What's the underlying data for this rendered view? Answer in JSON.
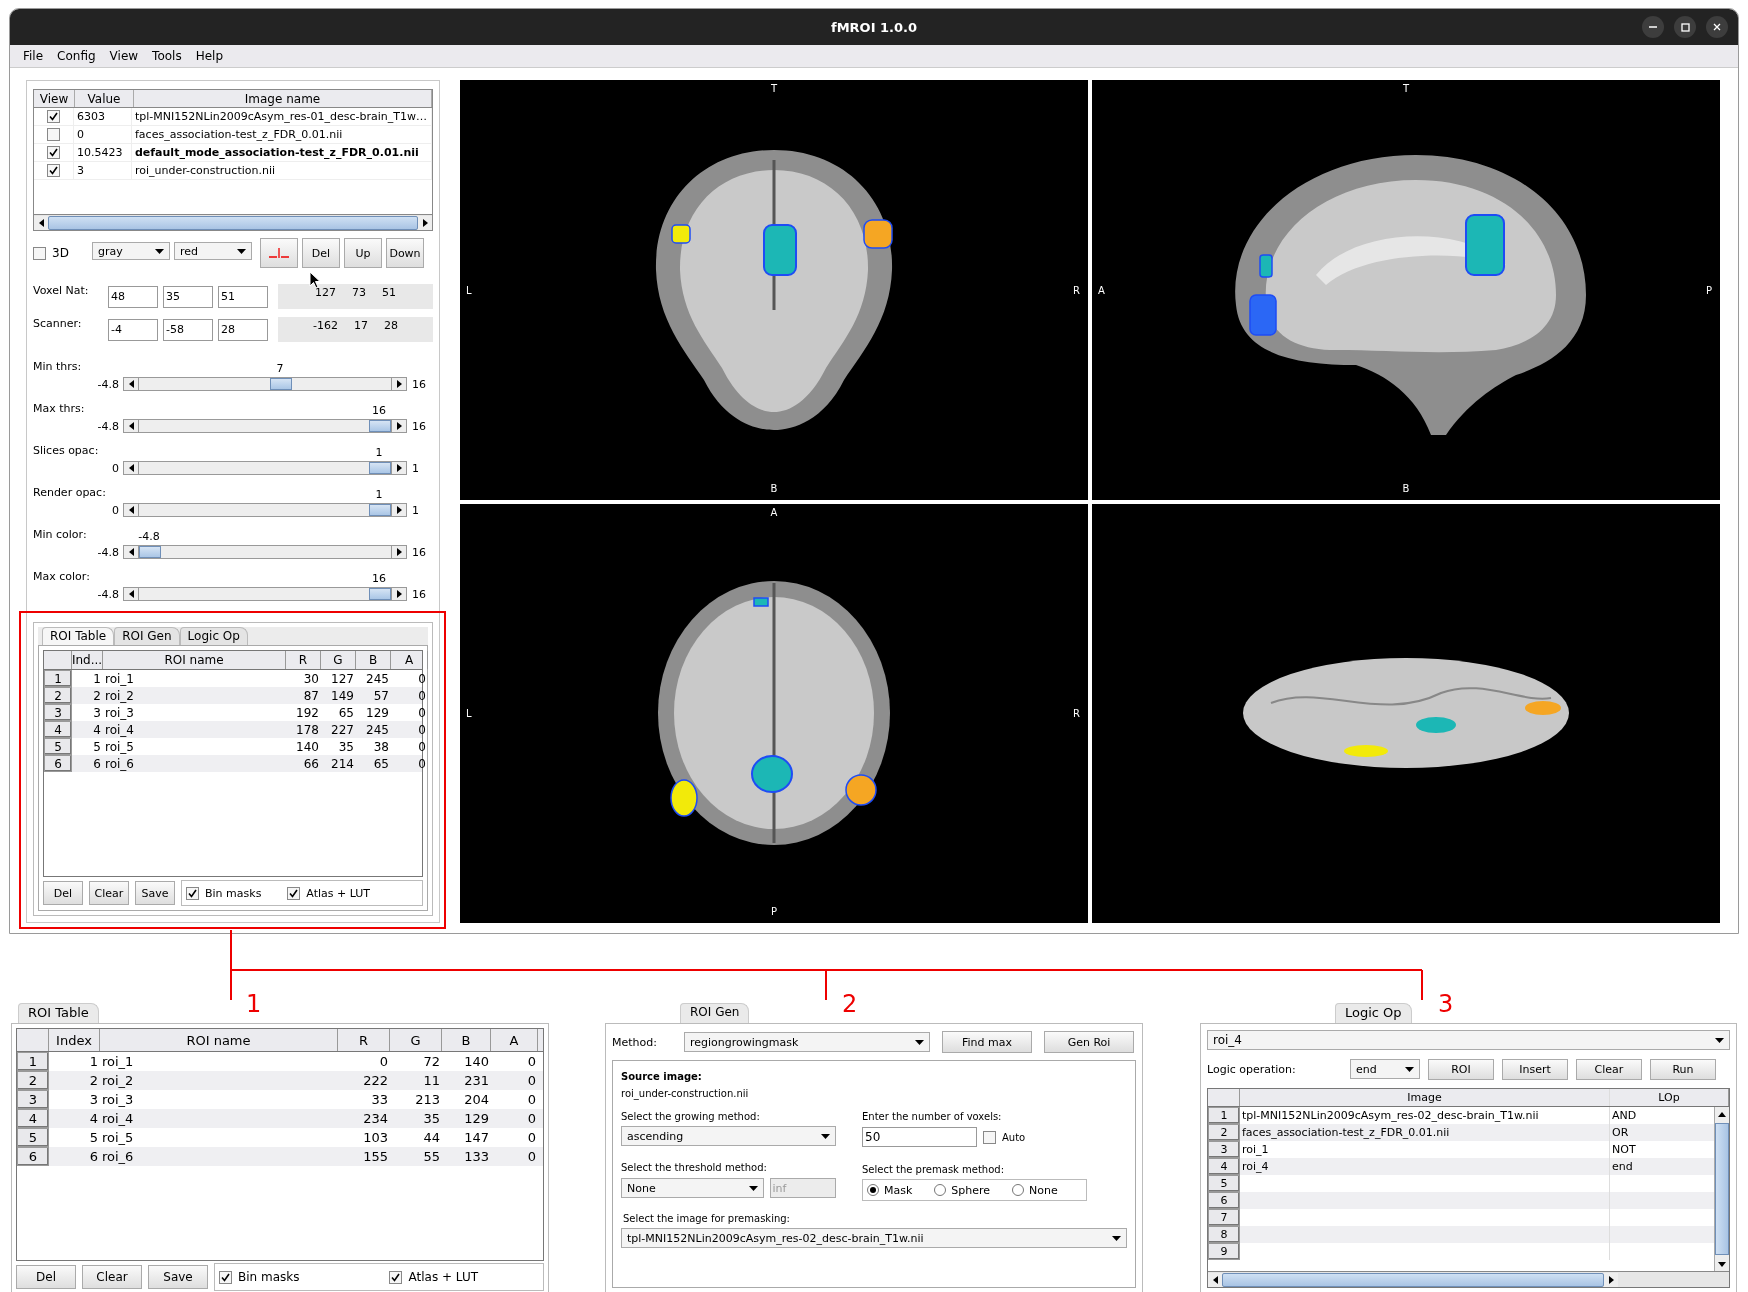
{
  "window": {
    "title": "fMROI 1.0.0"
  },
  "menu": [
    "File",
    "Config",
    "View",
    "Tools",
    "Help"
  ],
  "image_table": {
    "columns": [
      "View",
      "Value",
      "Image name"
    ],
    "rows": [
      {
        "checked": true,
        "value": "6303",
        "name": "tpl-MNI152NLin2009cAsym_res-01_desc-brain_T1w…",
        "selected": false
      },
      {
        "checked": false,
        "value": "0",
        "name": "faces_association-test_z_FDR_0.01.nii",
        "selected": false
      },
      {
        "checked": true,
        "value": "10.5423",
        "name": "default_mode_association-test_z_FDR_0.01.nii",
        "selected": true
      },
      {
        "checked": true,
        "value": "3",
        "name": "roi_under-construction.nii",
        "selected": false
      }
    ]
  },
  "display": {
    "three_d": {
      "label": "3D",
      "checked": false
    },
    "colormaps": [
      "gray",
      "red"
    ],
    "buttons": [
      "Del",
      "Up",
      "Down"
    ]
  },
  "coordinates": [
    {
      "label": "Voxel Nat:",
      "values": [
        "48",
        "35",
        "51"
      ],
      "readout": [
        "127",
        "73",
        "51"
      ]
    },
    {
      "label": "Scanner:",
      "values": [
        "-4",
        "-58",
        "28"
      ],
      "readout": [
        "-162",
        "17",
        "28"
      ]
    }
  ],
  "sliders": [
    {
      "label": "Min thrs:",
      "value": "7",
      "min": "-4.8",
      "max": "16",
      "level": 0.57
    },
    {
      "label": "Max thrs:",
      "value": "16",
      "min": "-4.8",
      "max": "16",
      "level": 1
    },
    {
      "label": "Slices opac:",
      "value": "1",
      "min": "0",
      "max": "1",
      "level": 1
    },
    {
      "label": "Render opac:",
      "value": "1",
      "min": "0",
      "max": "1",
      "level": 1
    },
    {
      "label": "Min color:",
      "value": "-4.8",
      "min": "-4.8",
      "max": "16",
      "level": 0
    },
    {
      "label": "Max color:",
      "value": "16",
      "min": "-4.8",
      "max": "16",
      "level": 1
    }
  ],
  "roi_panel": {
    "tabs": [
      {
        "label": "ROI Table",
        "selected": true
      },
      {
        "label": "ROI Gen",
        "selected": false
      },
      {
        "label": "Logic Op",
        "selected": false
      }
    ],
    "table": {
      "columns": [
        "Ind...",
        "ROI name",
        "R",
        "G",
        "B",
        "A"
      ],
      "rows": [
        {
          "number": "1",
          "index": "1",
          "name": "roi_1",
          "r": "30",
          "g": "127",
          "b": "245",
          "a": "0"
        },
        {
          "number": "2",
          "index": "2",
          "name": "roi_2",
          "r": "87",
          "g": "149",
          "b": "57",
          "a": "0"
        },
        {
          "number": "3",
          "index": "3",
          "name": "roi_3",
          "r": "192",
          "g": "65",
          "b": "129",
          "a": "0"
        },
        {
          "number": "4",
          "index": "4",
          "name": "roi_4",
          "r": "178",
          "g": "227",
          "b": "245",
          "a": "0"
        },
        {
          "number": "5",
          "index": "5",
          "name": "roi_5",
          "r": "140",
          "g": "35",
          "b": "38",
          "a": "0"
        },
        {
          "number": "6",
          "index": "6",
          "name": "roi_6",
          "r": "66",
          "g": "214",
          "b": "65",
          "a": "0"
        }
      ]
    },
    "buttons": [
      "Del",
      "Clear",
      "Save"
    ],
    "options": [
      {
        "label": "Bin masks",
        "checked": true
      },
      {
        "label": "Atlas + LUT",
        "checked": true
      }
    ]
  },
  "views": [
    {
      "kind": "coronal",
      "top": "T",
      "left": "L",
      "right": "R",
      "bottom": "B"
    },
    {
      "kind": "sagittal",
      "top": "T",
      "left": "A",
      "right": "P",
      "bottom": "B"
    },
    {
      "kind": "axial",
      "top": "A",
      "left": "L",
      "right": "R",
      "bottom": "P"
    },
    {
      "kind": "render"
    }
  ],
  "callouts": [
    "1",
    "2",
    "3"
  ],
  "zoom_roi_table": {
    "tab": "ROI Table",
    "columns": [
      "Index",
      "ROI name",
      "R",
      "G",
      "B",
      "A"
    ],
    "rows": [
      {
        "number": "1",
        "index": "1",
        "name": "roi_1",
        "r": "0",
        "g": "72",
        "b": "140",
        "a": "0"
      },
      {
        "number": "2",
        "index": "2",
        "name": "roi_2",
        "r": "222",
        "g": "11",
        "b": "231",
        "a": "0"
      },
      {
        "number": "3",
        "index": "3",
        "name": "roi_3",
        "r": "33",
        "g": "213",
        "b": "204",
        "a": "0"
      },
      {
        "number": "4",
        "index": "4",
        "name": "roi_4",
        "r": "234",
        "g": "35",
        "b": "129",
        "a": "0"
      },
      {
        "number": "5",
        "index": "5",
        "name": "roi_5",
        "r": "103",
        "g": "44",
        "b": "147",
        "a": "0"
      },
      {
        "number": "6",
        "index": "6",
        "name": "roi_6",
        "r": "155",
        "g": "55",
        "b": "133",
        "a": "0"
      }
    ],
    "buttons": [
      "Del",
      "Clear",
      "Save"
    ],
    "options": [
      {
        "label": "Bin masks",
        "checked": true
      },
      {
        "label": "Atlas + LUT",
        "checked": true
      }
    ]
  },
  "zoom_roi_gen": {
    "tab": "ROI Gen",
    "method_label": "Method:",
    "method": "regiongrowingmask",
    "buttons": [
      "Find max",
      "Gen Roi"
    ],
    "source_label": "Source image:",
    "source": "roi_under-construction.nii",
    "growing_label": "Select the growing method:",
    "growing": "ascending",
    "voxels_label": "Enter the number of voxels:",
    "voxels": "50",
    "auto": {
      "label": "Auto",
      "checked": false
    },
    "threshold_label": "Select the threshold method:",
    "threshold": "None",
    "threshold_value": {
      "value": "inf",
      "disabled": true
    },
    "premask_label": "Select the premask method:",
    "premask_options": [
      {
        "label": "Mask",
        "selected": true
      },
      {
        "label": "Sphere",
        "selected": false
      },
      {
        "label": "None",
        "selected": false
      }
    ],
    "premask_image_label": "Select the image for premasking:",
    "premask_image": "tpl-MNI152NLin2009cAsym_res-02_desc-brain_T1w.nii"
  },
  "zoom_logic_op": {
    "tab": "Logic Op",
    "roi": "roi_4",
    "operation_label": "Logic operation:",
    "operation": "end",
    "buttons": [
      "ROI",
      "Insert",
      "Clear",
      "Run"
    ],
    "columns": [
      "Image",
      "LOp"
    ],
    "rows": [
      {
        "number": "1",
        "image": "tpl-MNI152NLin2009cAsym_res-02_desc-brain_T1w.nii",
        "lop": "AND"
      },
      {
        "number": "2",
        "image": "faces_association-test_z_FDR_0.01.nii",
        "lop": "OR"
      },
      {
        "number": "3",
        "image": "roi_1",
        "lop": "NOT"
      },
      {
        "number": "4",
        "image": "roi_4",
        "lop": "end"
      },
      {
        "number": "5"
      },
      {
        "number": "6"
      },
      {
        "number": "7"
      },
      {
        "number": "8"
      },
      {
        "number": "9"
      }
    ]
  }
}
